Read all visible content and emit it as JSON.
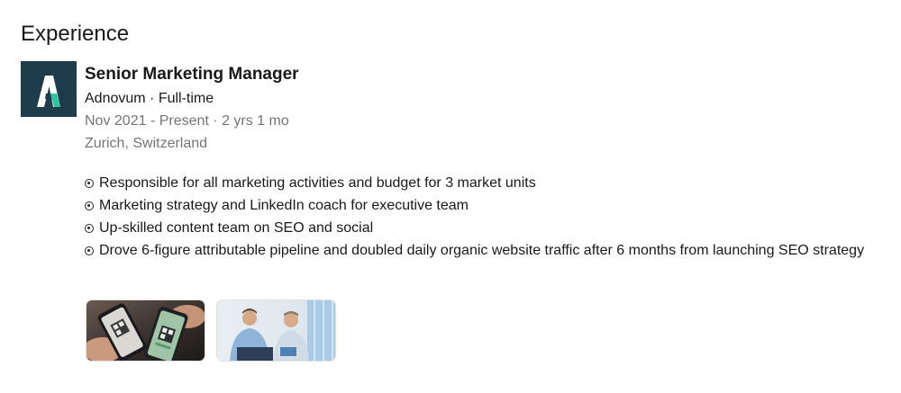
{
  "section": {
    "title": "Experience"
  },
  "experience": {
    "logo_icon": "adnovum-logo-icon",
    "title": "Senior Marketing Manager",
    "company_line": "Adnovum · Full-time",
    "date_range": "Nov 2021 - Present · 2 yrs 1 mo",
    "location": "Zurich, Switzerland",
    "bullets": [
      "Responsible for all marketing activities and budget for 3 market units",
      "Marketing strategy and LinkedIn coach for executive team",
      "Up-skilled content team on SEO and social",
      "Drove 6-figure attributable pipeline and doubled daily organic website traffic after 6 months from launching SEO strategy"
    ],
    "bullet_icon": "circle-dot-bullet-icon",
    "media": [
      {
        "icon": "phones-qr-code-image"
      },
      {
        "icon": "two-men-meeting-image"
      }
    ]
  },
  "colors": {
    "logo_background": "#1e3c4b",
    "logo_accent": "#2fc59a",
    "text_primary": "rgba(0,0,0,0.9)",
    "text_muted": "rgba(0,0,0,0.55)"
  }
}
